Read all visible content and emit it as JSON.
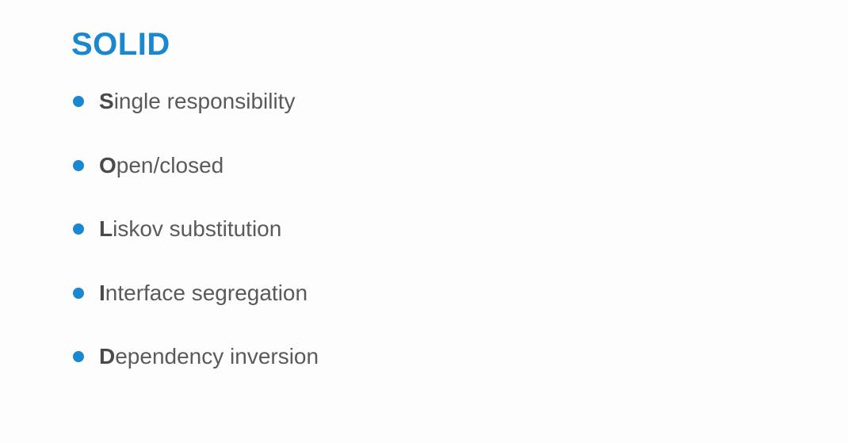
{
  "slide": {
    "title": "SOLID",
    "accent_color": "#1a88cf",
    "text_color": "#5a5a5a",
    "bullets": [
      {
        "initial": "S",
        "rest": "ingle responsibility"
      },
      {
        "initial": "O",
        "rest": "pen/closed"
      },
      {
        "initial": "L",
        "rest": "iskov substitution"
      },
      {
        "initial": "I",
        "rest": "nterface segregation"
      },
      {
        "initial": "D",
        "rest": "ependency inversion"
      }
    ]
  }
}
